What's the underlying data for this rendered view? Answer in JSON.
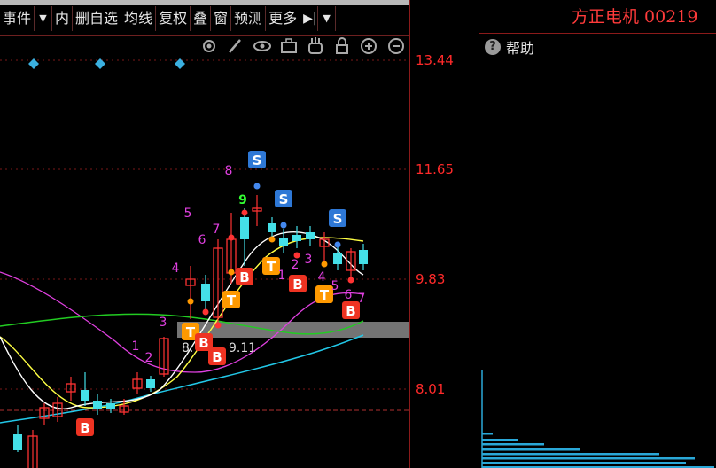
{
  "toolbar": {
    "items": [
      "事件",
      "内",
      "删自选",
      "均线",
      "复权",
      "叠",
      "窗",
      "预测",
      "更多"
    ]
  },
  "chart_icons": [
    "gear-icon",
    "pen-icon",
    "eye-icon",
    "briefcase-icon",
    "hand-icon",
    "lock-icon",
    "zoom-in-icon",
    "zoom-out-icon"
  ],
  "price_axis": {
    "labels": [
      "13.44",
      "11.65",
      "9.83",
      "8.01"
    ]
  },
  "stock": {
    "title": "方正电机 00219"
  },
  "help": {
    "label": "帮助"
  },
  "range_label": {
    "low": "8.",
    "high": "9.11"
  },
  "signals": {
    "T": "T",
    "B": "B",
    "S": "S",
    "counts": [
      "1",
      "2",
      "3",
      "4",
      "5",
      "6",
      "7",
      "8",
      "9",
      "1",
      "2",
      "3",
      "4",
      "5",
      "6",
      "7"
    ]
  },
  "colors": {
    "up": "#ff3333",
    "down": "#44e0e8",
    "price_axis": "#ff2a2a",
    "ma_white": "#ffffff",
    "ma_yellow": "#ffff44",
    "ma_magenta": "#e040e0",
    "ma_green": "#22cc22",
    "ma_cyan": "#22c8e8",
    "signal_T": "#ff9900",
    "signal_B": "#ee3322",
    "signal_S": "#2e78d6",
    "count_magenta": "#e040e0",
    "count_green": "#33ff33"
  }
}
